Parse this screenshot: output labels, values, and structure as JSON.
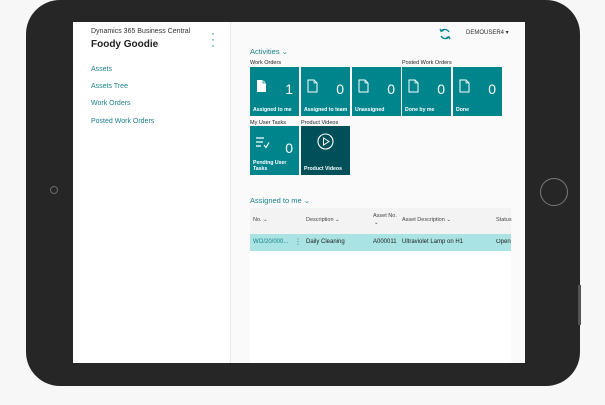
{
  "nav": {
    "app_name": "Dynamics 365 Business Central",
    "company": "Foody Goodie",
    "items": [
      {
        "label": "Assets"
      },
      {
        "label": "Assets Tree"
      },
      {
        "label": "Work Orders"
      },
      {
        "label": "Posted Work Orders"
      }
    ]
  },
  "header": {
    "user": "DEMOUSER4 ▾"
  },
  "activities": {
    "title": "Activities ⌄",
    "groups": {
      "work_orders": "Work Orders",
      "posted_work_orders": "Posted Work Orders",
      "my_user_tasks": "My User Tasks",
      "product_videos": "Product Videos"
    },
    "tiles": [
      {
        "label": "Assigned to me",
        "value": "1"
      },
      {
        "label": "Assigned to team",
        "value": "0"
      },
      {
        "label": "Unassigned",
        "value": "0"
      },
      {
        "label": "Done by me",
        "value": "0"
      },
      {
        "label": "Done",
        "value": "0"
      },
      {
        "label": "Pending User Tasks",
        "value": "0"
      },
      {
        "label": "Product Videos",
        "value": ""
      }
    ]
  },
  "list": {
    "title": "Assigned to me ⌄",
    "columns": [
      "No. ⌄",
      "Description ⌄",
      "Asset No.",
      "⌄",
      "Asset Description ⌄",
      "Status"
    ],
    "rows": [
      {
        "no": "WO/20/000...",
        "description": "Daily Cleaning",
        "asset_no": "A000011",
        "asset_description": "Ultraviolet Lamp on H1",
        "status": "Open"
      }
    ]
  },
  "colors": {
    "accent": "#00858d",
    "dark_tile": "#00505a",
    "selected_row": "#a9e3e3"
  }
}
